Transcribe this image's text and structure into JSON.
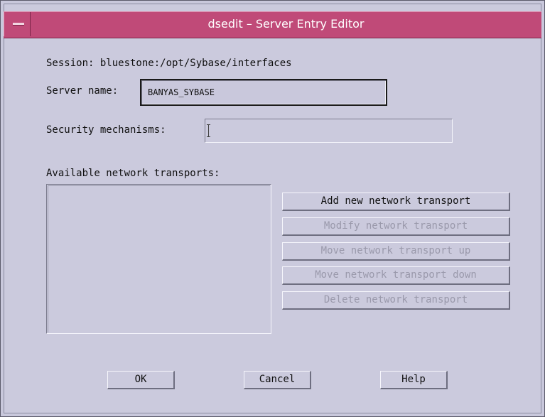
{
  "window": {
    "title": "dsedit – Server Entry Editor",
    "accent_color": "#c04a78",
    "background_color": "#cbcadd"
  },
  "session": {
    "label": "Session: bluestone:/opt/Sybase/interfaces"
  },
  "server_name": {
    "label": "Server name:",
    "value": "BANYAS_SYBASE"
  },
  "security": {
    "label": "Security mechanisms:",
    "value": ""
  },
  "transports": {
    "label": "Available network transports:",
    "items": []
  },
  "actions": {
    "add": "Add new network transport",
    "modify": "Modify network transport",
    "move_up": "Move network transport up",
    "move_down": "Move network transport down",
    "delete": "Delete network transport"
  },
  "footer": {
    "ok": "OK",
    "cancel": "Cancel",
    "help": "Help"
  }
}
